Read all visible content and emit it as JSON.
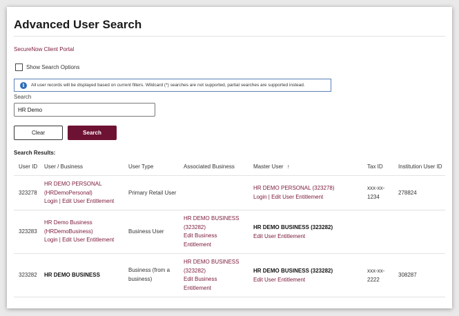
{
  "page": {
    "title": "Advanced User Search",
    "portal_link": "SecureNow Client Portal"
  },
  "options": {
    "show_search_label": "Show Search Options"
  },
  "info": {
    "message": "All user records will be displayed based on current filters. Wildcard (*) searches are not supported, partial searches are supported instead.",
    "icon": "i"
  },
  "search": {
    "label": "Search",
    "value": "HR Demo"
  },
  "buttons": {
    "clear": "Clear",
    "search": "Search"
  },
  "results": {
    "label": "Search Results:",
    "columns": [
      "User ID",
      "User / Business",
      "User Type",
      "Associated Business",
      "Master User",
      "Tax ID",
      "Institution User ID"
    ],
    "sort_indicator": "↑",
    "rows": [
      {
        "user_id": "323278",
        "user_l1": "HR DEMO PERSONAL",
        "user_l2": "(HRDemoPersonal)",
        "user_l3": "Login | Edit User Entitlement",
        "type": "Primary Retail User",
        "assoc": [],
        "master_l1": "HR DEMO PERSONAL (323278)",
        "master_l2": "Login | Edit User Entitlement",
        "tax_l1": "xxx-xx-",
        "tax_l2": "1234",
        "inst_id": "278824"
      },
      {
        "user_id": "323283",
        "user_l1": "HR Demo Business",
        "user_l2": "(HRDemoBusiness)",
        "user_l3": "Login | Edit User Entitlement",
        "type": "Business User",
        "assoc": [
          "HR DEMO BUSINESS",
          "(323282)",
          "Edit Business",
          "Entitlement"
        ],
        "master_l1": "HR DEMO BUSINESS (323282)",
        "master_l2": "Edit User Entitlement",
        "tax_l1": "",
        "tax_l2": "",
        "inst_id": ""
      },
      {
        "user_id": "323282",
        "user_l1": "HR DEMO BUSINESS",
        "type_l1": "Business (from a",
        "type_l2": "business)",
        "assoc": [
          "HR DEMO BUSINESS",
          "(323282)",
          "Edit Business",
          "Entitlement"
        ],
        "master_l1": "HR DEMO BUSINESS (323282)",
        "master_l2": "Edit User Entitlement",
        "tax_l1": "xxx-xx-",
        "tax_l2": "2222",
        "inst_id": "308287"
      }
    ]
  }
}
